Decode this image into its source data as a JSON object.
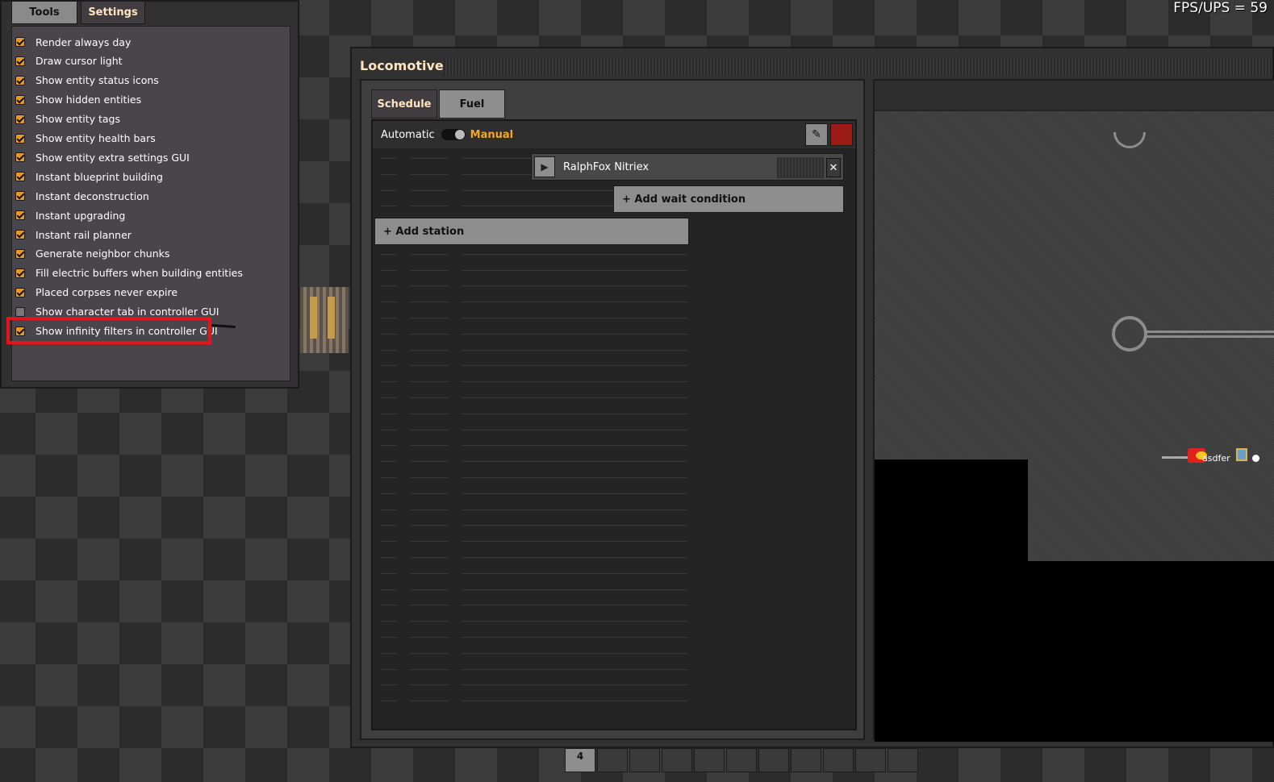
{
  "hud": {
    "fps_text": "FPS/UPS = 59"
  },
  "editor": {
    "tabs": [
      {
        "label": "Tools",
        "active": false
      },
      {
        "label": "Settings",
        "active": true
      }
    ],
    "settings": [
      {
        "label": "Render always day",
        "checked": true
      },
      {
        "label": "Draw cursor light",
        "checked": true
      },
      {
        "label": "Show entity status icons",
        "checked": true
      },
      {
        "label": "Show hidden entities",
        "checked": true
      },
      {
        "label": "Show entity tags",
        "checked": true
      },
      {
        "label": "Show entity health bars",
        "checked": true
      },
      {
        "label": "Show entity extra settings GUI",
        "checked": true
      },
      {
        "label": "Instant blueprint building",
        "checked": true
      },
      {
        "label": "Instant deconstruction",
        "checked": true
      },
      {
        "label": "Instant upgrading",
        "checked": true
      },
      {
        "label": "Instant rail planner",
        "checked": true
      },
      {
        "label": "Generate neighbor chunks",
        "checked": true
      },
      {
        "label": "Fill electric buffers when building entities",
        "checked": true
      },
      {
        "label": "Placed corpses never expire",
        "checked": true
      },
      {
        "label": "Show character tab in controller GUI",
        "checked": false
      },
      {
        "label": "Show infinity filters in controller GUI",
        "checked": true
      }
    ]
  },
  "locomotive": {
    "title": "Locomotive",
    "tabs": [
      {
        "label": "Schedule",
        "active": true
      },
      {
        "label": "Fuel",
        "active": false
      }
    ],
    "mode": {
      "automatic_label": "Automatic",
      "manual_label": "Manual"
    },
    "stations": [
      {
        "name": "RalphFox Nitriex"
      }
    ],
    "add_wait_condition_label": "+ Add wait condition",
    "add_station_label": "+ Add station"
  },
  "minimap": {
    "train_label": "asdfer"
  },
  "toolbar": {
    "page_number": "4"
  },
  "colors": {
    "accent": "#e59a27",
    "highlight": "#e0161c",
    "manual": "#f5a623"
  }
}
